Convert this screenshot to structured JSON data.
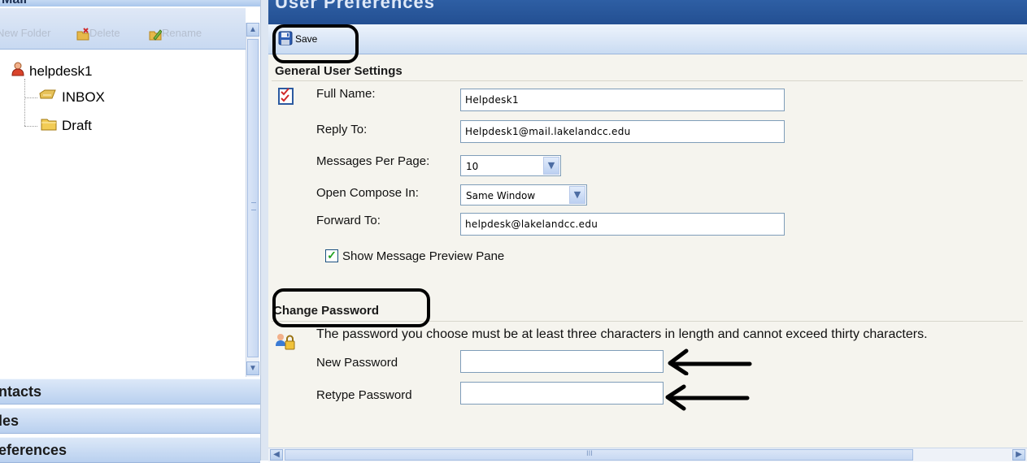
{
  "left": {
    "header_title": "Mail",
    "toolbar": {
      "new_folder": "New Folder",
      "delete": "Delete",
      "rename": "Rename"
    },
    "tree": {
      "root": "helpdesk1",
      "folders": [
        "INBOX",
        "Draft"
      ]
    },
    "nav": [
      "ntacts",
      "les",
      "eferences"
    ]
  },
  "right": {
    "header_title": "User Preferences",
    "save_label": "Save",
    "general": {
      "title": "General User Settings",
      "full_name_label": "Full Name:",
      "full_name_value": "Helpdesk1",
      "reply_to_label": "Reply To:",
      "reply_to_value": "Helpdesk1@mail.lakelandcc.edu",
      "messages_per_page_label": "Messages Per Page:",
      "messages_per_page_value": "10",
      "open_compose_label": "Open Compose In:",
      "open_compose_value": "Same Window",
      "forward_to_label": "Forward To:",
      "forward_to_value": "helpdesk@lakelandcc.edu",
      "preview_pane_label": "Show Message Preview Pane",
      "preview_pane_checked": true
    },
    "password": {
      "title": "Change Password",
      "note": "The password you choose must be at least three characters in length and cannot exceed thirty characters.",
      "new_label": "New Password",
      "retype_label": "Retype Password",
      "new_value": "",
      "retype_value": ""
    },
    "scroll_h_grip": "III"
  },
  "colors": {
    "header_blue": "#2b5b9f",
    "panel_bg": "#f5f4ee",
    "nav_gradient": "#b9d0ef",
    "input_border": "#7f9db9"
  }
}
